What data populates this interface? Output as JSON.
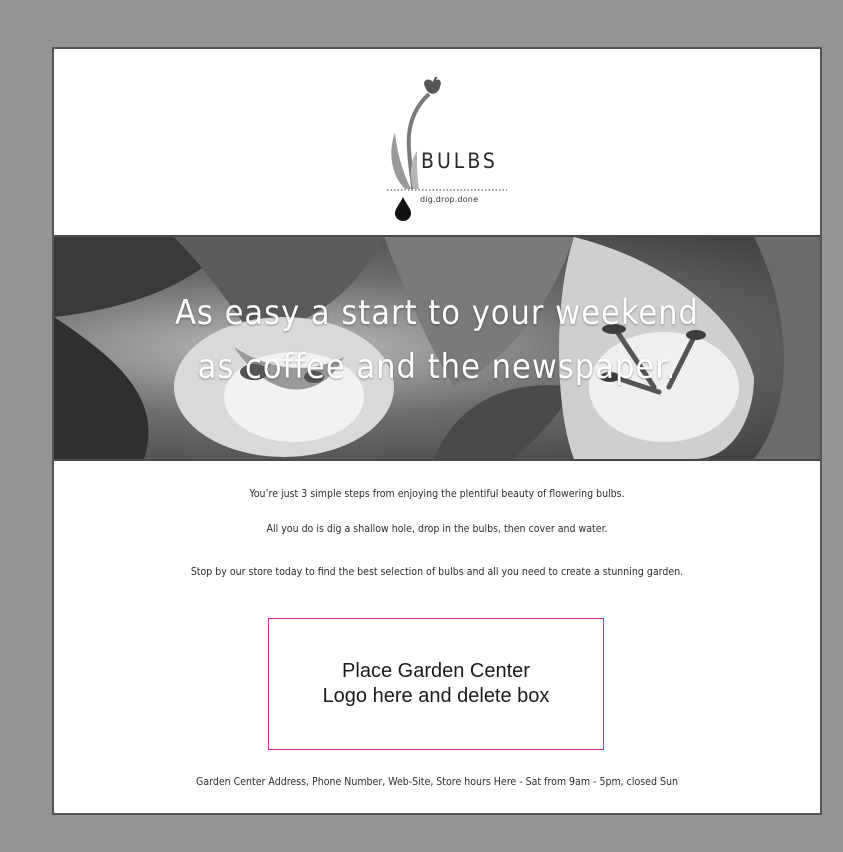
{
  "brand": {
    "name": "BULBS",
    "tagline": "dig.drop.done"
  },
  "hero": {
    "line1": "As easy a start to your weekend",
    "line2": "as coffee and the newspaper."
  },
  "body": {
    "paragraph1": "You’re just 3 simple steps from enjoying the plentiful beauty of flowering bulbs.",
    "paragraph2": "All you do is dig a shallow hole, drop in the bulbs, then cover and water.",
    "paragraph3": "Stop by our store today to find the best selection of bulbs and all you need to create a stunning garden."
  },
  "placeholder": {
    "line1": "Place Garden Center",
    "line2": "Logo here and delete box",
    "border_color": "#e0258f"
  },
  "footer": {
    "text": "Garden Center Address, Phone Number, Web-Site, Store hours Here - Sat from 9am - 5pm, closed Sun"
  },
  "colors": {
    "outer_background": "#949494",
    "sheet_background": "#ffffff"
  },
  "icons": {
    "brand_mark": "tulip-bulb-logo-icon",
    "drop": "water-drop-icon"
  }
}
